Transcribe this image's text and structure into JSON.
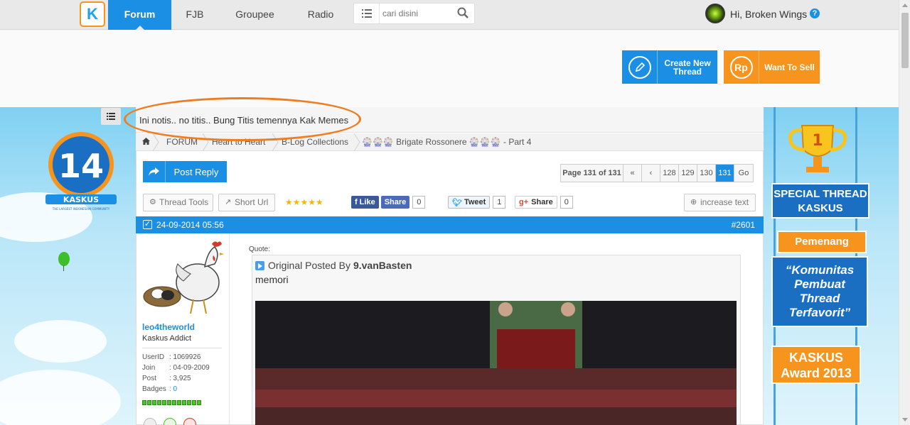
{
  "nav": {
    "tabs": [
      {
        "label": "Forum",
        "active": true
      },
      {
        "label": "FJB",
        "active": false
      },
      {
        "label": "Groupee",
        "active": false
      },
      {
        "label": "Radio",
        "active": false
      }
    ],
    "search_placeholder": "cari disini",
    "greeting": "Hi, Broken Wings",
    "help": "?"
  },
  "actions": {
    "create_thread": "Create New Thread",
    "want_to_sell": "Want To Sell",
    "sell_icon": "Rp"
  },
  "notice": "Ini notis.. no titis.. Bung Titis temennya Kak Memes",
  "breadcrumb": [
    "FORUM",
    "Heart to Heart",
    "B-Log Collections",
    "🎡🎡🎡 Brigate Rossonere 🎡🎡🎡 - Part 4"
  ],
  "thread": {
    "post_reply": "Post Reply",
    "pager": {
      "info": "Page 131 of 131",
      "pages": [
        "128",
        "129",
        "130",
        "131"
      ],
      "current": "131",
      "go": "Go"
    },
    "tools": {
      "thread_tools": "Thread Tools",
      "short_url": "Short Url",
      "increase_text": "increase text"
    },
    "rating": 5,
    "social": {
      "fb_like": "Like",
      "fb_share": "Share",
      "fb_count": "0",
      "tweet": "Tweet",
      "tweet_count": "1",
      "gplus_share": "Share",
      "gplus_count": "0"
    }
  },
  "post": {
    "date": "24-09-2014 05:56",
    "number": "#2601",
    "user": {
      "name": "leo4theworld",
      "rank": "Kaskus Addict",
      "stats": [
        {
          "key": "UserID",
          "value": ": 1069926"
        },
        {
          "key": "Join",
          "value": ": 04-09-2009"
        },
        {
          "key": "Post",
          "value": ": 3,925"
        },
        {
          "key": "Badges",
          "value": ": 0"
        }
      ],
      "reputation_bars": 12
    },
    "quote_label": "Quote:",
    "quote_prefix": "Original Posted By",
    "quote_author": "9.vanBasten",
    "quote_text": "memori"
  },
  "award": {
    "title": "SPECIAL THREAD KASKUS",
    "winner": "Pemenang",
    "category": "“Komunitas Pembuat Thread Terfavorit”",
    "event": "KASKUS Award 2013",
    "trophy_number": "1"
  },
  "colors": {
    "primary": "#1a8fe3",
    "accent": "#f7941d",
    "highlight_ring": "#f07c20"
  }
}
